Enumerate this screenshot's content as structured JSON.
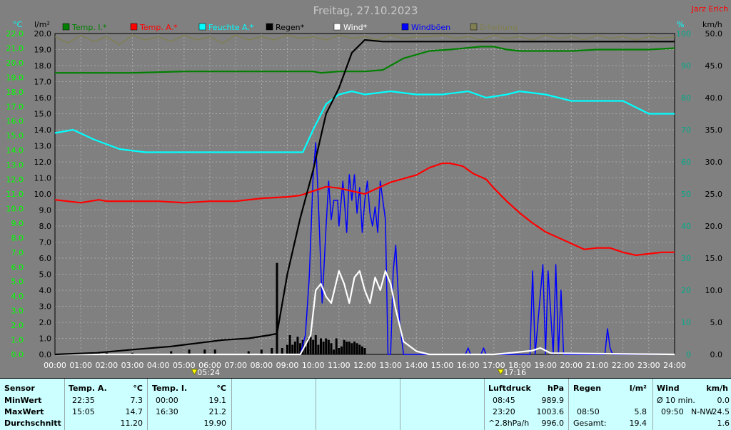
{
  "header": {
    "title": "Freitag, 27.10.2023",
    "station": "Jarz Erich"
  },
  "units": {
    "left1": "°C",
    "left2": "l/m²",
    "right1": "%",
    "right2": "km/h"
  },
  "legend": [
    {
      "label": "Temp. I.*",
      "color": "#008000"
    },
    {
      "label": "Temp. A.*",
      "color": "#ff0000"
    },
    {
      "label": "Feuchte A.*",
      "color": "#00ffff"
    },
    {
      "label": "Regen*",
      "color": "#000000"
    },
    {
      "label": "Wind*",
      "color": "#ffffff"
    },
    {
      "label": "Windböen",
      "color": "#0000ff"
    },
    {
      "label": "Erhebung",
      "color": "#7f7f52"
    }
  ],
  "axes": {
    "temp_ticks": [
      "22.0",
      "21.0",
      "20.0",
      "19.0",
      "18.0",
      "17.0",
      "16.0",
      "15.0",
      "14.0",
      "13.0",
      "12.0",
      "11.0",
      "10.0",
      "9.0",
      "8.0",
      "7.0",
      "6.0",
      "5.0",
      "4.0",
      "3.0",
      "2.0",
      "1.0",
      "0.0"
    ],
    "rain_ticks": [
      "20.0",
      "19.0",
      "18.0",
      "17.0",
      "16.0",
      "15.0",
      "14.0",
      "13.0",
      "12.0",
      "11.0",
      "10.0",
      "9.0",
      "8.0",
      "7.0",
      "6.0",
      "5.0",
      "4.0",
      "3.0",
      "2.0",
      "1.0",
      "0.0"
    ],
    "hum_ticks": [
      "100",
      "90",
      "80",
      "70",
      "60",
      "50",
      "40",
      "30",
      "20",
      "10",
      "0"
    ],
    "wind_ticks": [
      "50.0",
      "45.0",
      "40.0",
      "35.0",
      "30.0",
      "25.0",
      "20.0",
      "15.0",
      "10.0",
      "5.0",
      "0.0"
    ],
    "time_ticks": [
      "00:00",
      "01:00",
      "02:00",
      "03:00",
      "04:00",
      "05:00",
      "06:00",
      "07:00",
      "08:00",
      "09:00",
      "10:00",
      "11:00",
      "12:00",
      "13:00",
      "14:00",
      "15:00",
      "16:00",
      "17:00",
      "18:00",
      "19:00",
      "20:00",
      "21:00",
      "22:00",
      "23:00",
      "24:00"
    ],
    "sunrise": "05:24",
    "sunset": "17:16"
  },
  "chart_data": {
    "type": "line",
    "title": "Freitag, 27.10.2023",
    "x_range": [
      0,
      24
    ],
    "temp_range": [
      0,
      22
    ],
    "rain_range": [
      0,
      20
    ],
    "hum_range": [
      0,
      100
    ],
    "wind_range": [
      0,
      50
    ],
    "grid": true,
    "series": [
      {
        "name": "Temp. I.*",
        "axis": "temp",
        "color": "#008000",
        "x": [
          0,
          3,
          5,
          8,
          10,
          10.3,
          11,
          12,
          12.7,
          13.5,
          14.5,
          15.3,
          16.5,
          17,
          17.5,
          18,
          19,
          20,
          21,
          22,
          23,
          24
        ],
        "y": [
          19.3,
          19.3,
          19.4,
          19.4,
          19.4,
          19.3,
          19.4,
          19.4,
          19.5,
          20.3,
          20.8,
          20.9,
          21.1,
          21.1,
          20.9,
          20.8,
          20.8,
          20.8,
          20.9,
          20.9,
          20.9,
          21.0
        ]
      },
      {
        "name": "Temp. A.*",
        "axis": "temp",
        "color": "#ff0000",
        "x": [
          0,
          1,
          1.7,
          2,
          3,
          4,
          5,
          6,
          7,
          8,
          9,
          9.5,
          10,
          10.5,
          11,
          11.5,
          12,
          12.5,
          13,
          14,
          14.5,
          15,
          15.3,
          15.8,
          16.2,
          16.7,
          17,
          17.5,
          18,
          18.5,
          19,
          19.5,
          20,
          20.5,
          21,
          21.5,
          22,
          22.5,
          23,
          23.5,
          24
        ],
        "y": [
          10.6,
          10.4,
          10.6,
          10.5,
          10.5,
          10.5,
          10.4,
          10.5,
          10.5,
          10.7,
          10.8,
          10.9,
          11.2,
          11.5,
          11.4,
          11.2,
          11.0,
          11.4,
          11.8,
          12.3,
          12.8,
          13.1,
          13.1,
          12.9,
          12.4,
          12.0,
          11.4,
          10.5,
          9.7,
          9.0,
          8.4,
          8.0,
          7.6,
          7.2,
          7.3,
          7.3,
          7.0,
          6.8,
          6.9,
          7.0,
          7.0
        ]
      },
      {
        "name": "Feuchte A.*",
        "axis": "hum",
        "color": "#00ffff",
        "x": [
          0,
          0.7,
          1.5,
          2.5,
          3.5,
          5,
          7,
          9,
          9.6,
          10,
          10.5,
          11,
          11.5,
          12,
          13,
          14,
          15,
          16,
          16.7,
          17.5,
          18,
          19,
          20,
          21,
          22,
          23,
          24
        ],
        "y": [
          69,
          70,
          67,
          64,
          63,
          63,
          63,
          63,
          63,
          70,
          78,
          81,
          82,
          81,
          82,
          81,
          81,
          82,
          80,
          81,
          82,
          81,
          79,
          79,
          79,
          75,
          75
        ]
      },
      {
        "name": "Regen*",
        "axis": "rain",
        "color": "#000000",
        "x": [
          0,
          1.6,
          3,
          4.5,
          5.5,
          6.5,
          7.5,
          8.3,
          8.6,
          9,
          9.5,
          10,
          10.5,
          11,
          11.5,
          12,
          12.7,
          13,
          15,
          17,
          24
        ],
        "y": [
          0.0,
          0.1,
          0.3,
          0.5,
          0.7,
          0.9,
          1.0,
          1.2,
          1.3,
          5.0,
          8.5,
          11.5,
          15.0,
          16.6,
          18.8,
          19.6,
          19.5,
          19.5,
          19.5,
          19.5,
          19.5
        ]
      },
      {
        "name": "Wind*",
        "axis": "wind",
        "color": "#ffffff",
        "x": [
          0,
          9.5,
          9.9,
          10.1,
          10.3,
          10.5,
          10.7,
          11,
          11.2,
          11.4,
          11.6,
          11.8,
          12,
          12.2,
          12.4,
          12.6,
          12.8,
          13,
          13.2,
          13.5,
          14,
          14.5,
          17,
          17.8,
          18.5,
          18.8,
          19.2,
          24
        ],
        "y": [
          0,
          0,
          3,
          10,
          11,
          9,
          8,
          13,
          11,
          8,
          12,
          13,
          10,
          8,
          12,
          10,
          13,
          11,
          7,
          2,
          0.5,
          0,
          0,
          0.3,
          0.6,
          1,
          0.2,
          0
        ]
      },
      {
        "name": "Windböen",
        "axis": "wind",
        "color": "#0000ff",
        "x": [
          0,
          9.5,
          9.7,
          9.85,
          10,
          10.1,
          10.2,
          10.35,
          10.5,
          10.6,
          10.7,
          10.8,
          10.95,
          11,
          11.15,
          11.3,
          11.4,
          11.5,
          11.6,
          11.7,
          11.8,
          11.9,
          12.0,
          12.1,
          12.2,
          12.3,
          12.4,
          12.5,
          12.6,
          12.7,
          12.8,
          12.9,
          13.0,
          13.1,
          13.2,
          13.35,
          13.5,
          13.6,
          13.8,
          15.9,
          16.0,
          16.1,
          16.5,
          16.6,
          16.7,
          16.8,
          18.4,
          18.5,
          18.6,
          18.9,
          19.0,
          19.1,
          19.3,
          19.4,
          19.5,
          19.6,
          19.7,
          19.8,
          21.3,
          21.4,
          21.5,
          21.6,
          24
        ],
        "y": [
          0,
          0,
          3,
          12,
          28,
          33,
          24,
          8,
          20,
          27,
          21,
          24,
          24,
          20,
          27,
          19,
          28,
          24,
          28,
          22,
          26,
          19,
          24,
          27,
          22,
          20,
          23,
          19,
          27,
          24,
          21,
          0,
          0,
          13,
          17,
          5,
          0,
          0,
          0,
          0,
          1,
          0,
          0,
          1,
          0,
          0,
          0,
          13,
          0,
          14,
          0,
          13,
          0,
          14,
          0,
          10,
          0,
          0,
          0,
          4,
          1,
          0,
          0
        ]
      }
    ],
    "extra_series": [
      {
        "name": "Regen-Intervall",
        "axis": "rain",
        "color": "#000000",
        "type": "bar",
        "x": [
          1.7,
          2.0,
          3.0,
          4.5,
          5.2,
          5.8,
          6.2,
          7.5,
          8.0,
          8.4,
          8.6,
          8.8,
          9.0,
          9.1,
          9.2,
          9.3,
          9.4,
          9.5,
          9.6,
          9.7,
          9.8,
          9.9,
          10.0,
          10.1,
          10.2,
          10.3,
          10.4,
          10.5,
          10.6,
          10.7,
          10.8,
          10.9,
          11.0,
          11.1,
          11.2,
          11.3,
          11.4,
          11.5,
          11.6,
          11.7,
          11.8,
          11.9,
          12.0
        ],
        "y": [
          0.1,
          0.1,
          0.1,
          0.2,
          0.3,
          0.3,
          0.3,
          0.2,
          0.3,
          0.4,
          5.7,
          0.4,
          0.6,
          1.2,
          0.6,
          0.8,
          1.1,
          0.7,
          0.9,
          0.5,
          1.0,
          1.1,
          0.9,
          1.2,
          0.6,
          1.0,
          0.8,
          1.0,
          0.9,
          0.7,
          0.3,
          1.0,
          0.4,
          0.5,
          0.9,
          0.8,
          0.8,
          0.7,
          0.8,
          0.7,
          0.6,
          0.5,
          0.4
        ]
      },
      {
        "name": "Erhebung",
        "axis": "rain",
        "color": "#7f7f52",
        "x": [
          0,
          0.5,
          1,
          1.5,
          2,
          2.5,
          3,
          3.5,
          4,
          4.5,
          5,
          5.5,
          6,
          6.5,
          7,
          7.5,
          8,
          8.5,
          9,
          9.5,
          10,
          10.5,
          11,
          11.5,
          12,
          12.5,
          13,
          13.5,
          14,
          14.5,
          15,
          15.5,
          16,
          16.5,
          17,
          17.5,
          18,
          18.5,
          19,
          19.5,
          20,
          20.5,
          21,
          21.5,
          22,
          22.5,
          23,
          23.5,
          24
        ],
        "y": [
          19.8,
          19.4,
          19.9,
          19.5,
          19.8,
          19.3,
          19.9,
          19.6,
          19.8,
          19.5,
          19.9,
          19.6,
          19.8,
          19.4,
          19.9,
          19.6,
          19.8,
          19.6,
          19.9,
          19.7,
          19.8,
          19.6,
          19.9,
          19.7,
          19.8,
          19.6,
          19.9,
          19.7,
          19.8,
          19.8,
          19.9,
          19.7,
          19.8,
          19.6,
          19.9,
          19.7,
          19.8,
          19.6,
          19.9,
          19.7,
          19.8,
          19.6,
          19.9,
          19.7,
          19.8,
          19.6,
          19.8,
          19.7,
          19.8
        ]
      }
    ]
  },
  "footer": {
    "sensor": {
      "header": "Sensor",
      "rows": [
        "MinWert",
        "MaxWert",
        "Durchschnitt"
      ]
    },
    "temp_a": {
      "header": "Temp. A.",
      "unit": "°C",
      "times": [
        "22:35",
        "15:05",
        ""
      ],
      "values": [
        "7.3",
        "14.7",
        "11.20"
      ]
    },
    "temp_i": {
      "header": "Temp. I.",
      "unit": "°C",
      "times": [
        "00:00",
        "16:30",
        ""
      ],
      "values": [
        "19.1",
        "21.2",
        "19.90"
      ]
    },
    "pressure": {
      "header": "Luftdruck",
      "unit": "hPa",
      "times": [
        "08:45",
        "23:20",
        "^2.8hPa/h"
      ],
      "values": [
        "989.9",
        "1003.6",
        "996.0"
      ]
    },
    "rain": {
      "header": "Regen",
      "unit": "l/m²",
      "times": [
        "",
        "08:50",
        "Gesamt:"
      ],
      "values": [
        "",
        "5.8",
        "19.4"
      ]
    },
    "wind": {
      "header": "Wind",
      "unit": "km/h",
      "times": [
        "Ø 10 min.",
        "09:50",
        ""
      ],
      "dirs": [
        "",
        "N-NW",
        ""
      ],
      "values": [
        "0.0",
        "24.5",
        "1.6"
      ]
    }
  }
}
